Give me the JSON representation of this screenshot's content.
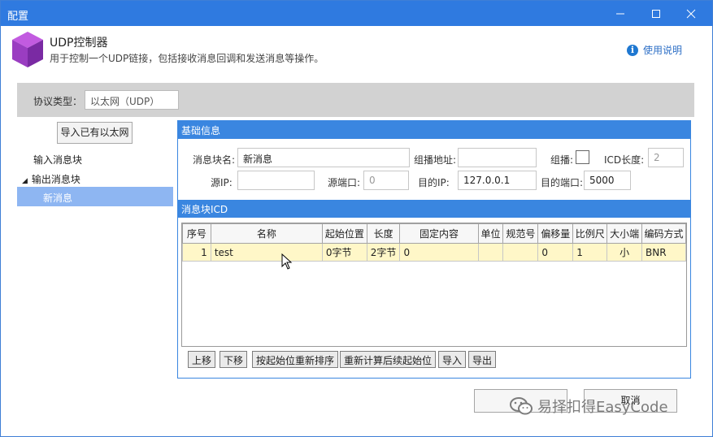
{
  "window": {
    "title": "配置",
    "controls": [
      "minimize",
      "maximize",
      "close"
    ]
  },
  "header": {
    "title": "UDP控制器",
    "description": "用于控制一个UDP链接，包括接收消息回调和发送消息等操作。",
    "help_label": "使用说明",
    "help_icon": "info-icon",
    "app_icon": "purple-cube-icon"
  },
  "protocol": {
    "label": "协议类型：",
    "value": "以太网（UDP）"
  },
  "left": {
    "import_button": "导入已有以太网",
    "tree": [
      {
        "label": "输入消息块"
      },
      {
        "label": "输出消息块",
        "expanded": true
      },
      {
        "label": "新消息",
        "selected": true
      }
    ]
  },
  "basic_info": {
    "title": "基础信息",
    "msg_name_label": "消息块名:",
    "msg_name_value": "新消息",
    "multicast_addr_label": "组播地址:",
    "multicast_addr_value": "",
    "multicast_label": "组播:",
    "multicast_checked": false,
    "icd_len_label": "ICD长度:",
    "icd_len_value": "2",
    "src_ip_label": "源IP:",
    "src_ip_value": "",
    "src_port_label": "源端口:",
    "src_port_value": "0",
    "dst_ip_label": "目的IP:",
    "dst_ip_value": "127.0.0.1",
    "dst_port_label": "目的端口:",
    "dst_port_value": "5000"
  },
  "icd": {
    "title": "消息块ICD",
    "columns": [
      "序号",
      "名称",
      "起始位置",
      "长度",
      "固定内容",
      "单位",
      "规范号",
      "偏移量",
      "比例尺",
      "大小端",
      "编码方式"
    ],
    "rows": [
      [
        "1",
        "test",
        "0字节",
        "2字节",
        "0",
        "",
        "",
        "0",
        "1",
        "小",
        "BNR"
      ]
    ],
    "buttons": [
      "上移",
      "下移",
      "按起始位重新排序",
      "重新计算后续起始位",
      "导入",
      "导出"
    ]
  },
  "footer": {
    "cancel_label": "取消"
  },
  "watermark": {
    "text": "易择扣得EasyCode"
  },
  "colors": {
    "titlebar": "#2f7ae0",
    "panel_header": "#3a86e0",
    "tree_selected": "#8eb6f2",
    "row_highlight": "#fff7c8",
    "protocol_bar": "#d2d2d2"
  }
}
